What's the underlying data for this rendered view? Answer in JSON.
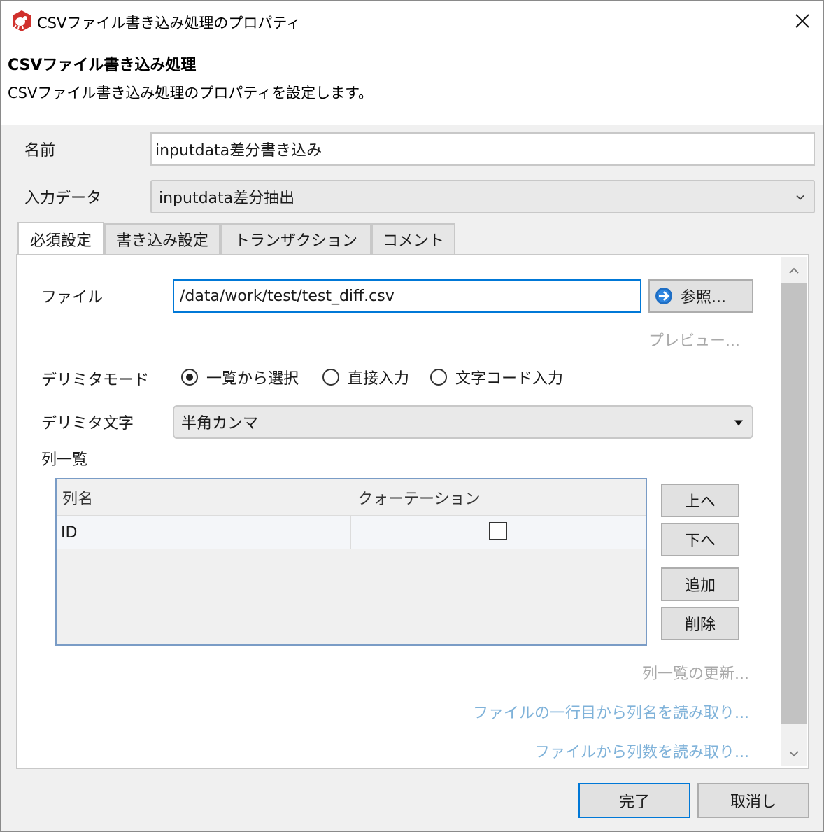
{
  "window": {
    "title": "CSVファイル書き込み処理のプロパティ",
    "icon": "app-bug-icon",
    "accent_color": "#0078d7"
  },
  "header": {
    "title": "CSVファイル書き込み処理",
    "description": "CSVファイル書き込み処理のプロパティを設定します。"
  },
  "form": {
    "name_label": "名前",
    "name_value": "inputdata差分書き込み",
    "input_label": "入力データ",
    "input_value": "inputdata差分抽出"
  },
  "tabs": [
    {
      "label": "必須設定",
      "active": true
    },
    {
      "label": "書き込み設定",
      "active": false
    },
    {
      "label": "トランザクション",
      "active": false
    },
    {
      "label": "コメント",
      "active": false
    }
  ],
  "required": {
    "file_label": "ファイル",
    "file_value": "/data/work/test/test_diff.csv",
    "browse_label": "参照...",
    "preview_label": "プレビュー...",
    "delimiter_mode_label": "デリミタモード",
    "delimiter_modes": [
      {
        "label": "一覧から選択",
        "checked": true
      },
      {
        "label": "直接入力",
        "checked": false
      },
      {
        "label": "文字コード入力",
        "checked": false
      }
    ],
    "delimiter_char_label": "デリミタ文字",
    "delimiter_char_value": "半角カンマ",
    "columns_label": "列一覧",
    "table": {
      "headers": [
        "列名",
        "クォーテーション"
      ],
      "rows": [
        {
          "name": "ID",
          "quotation": false
        }
      ]
    },
    "buttons": {
      "up": "上へ",
      "down": "下へ",
      "add": "追加",
      "delete": "削除"
    },
    "links": {
      "refresh_columns": "列一覧の更新...",
      "read_header": "ファイルの一行目から列名を読み取り...",
      "read_count": "ファイルから列数を読み取り..."
    }
  },
  "footer": {
    "ok_label": "完了",
    "cancel_label": "取消し"
  }
}
